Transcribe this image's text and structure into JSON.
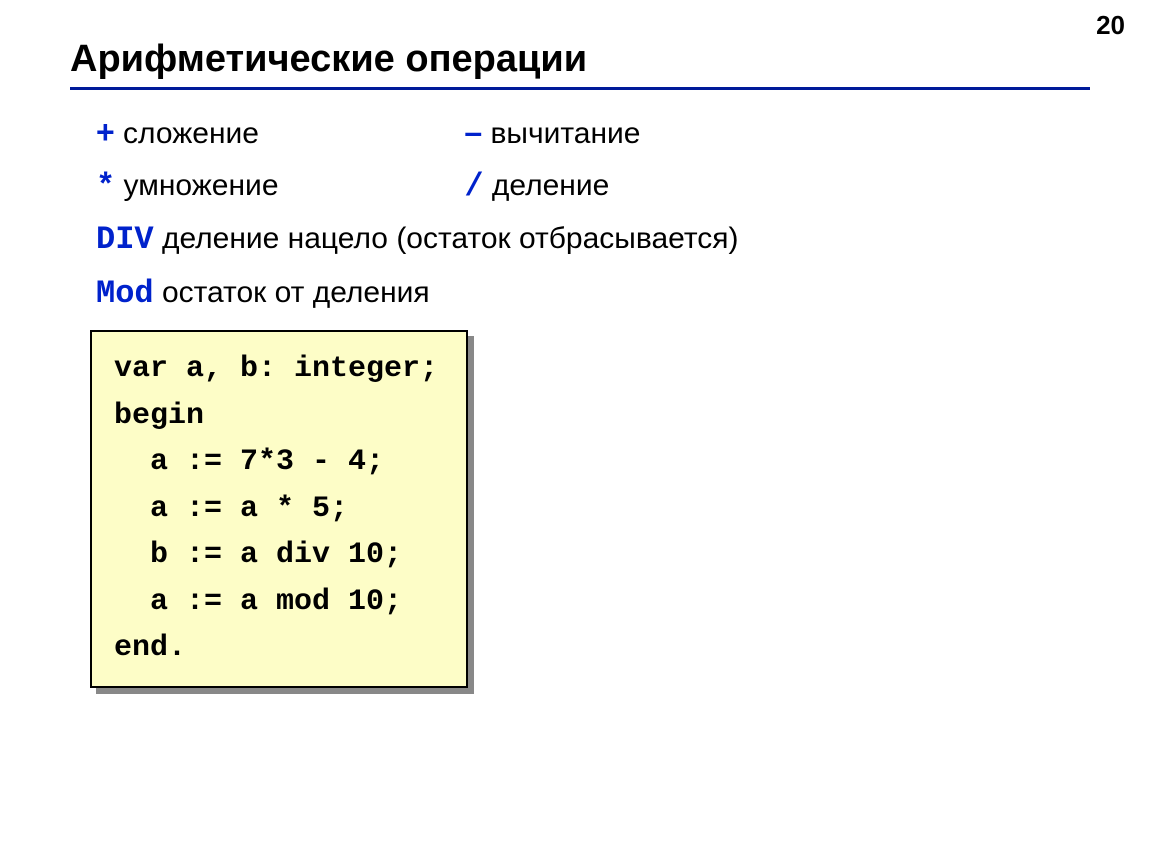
{
  "page_number": "20",
  "title": "Арифметические операции",
  "ops": {
    "plus_sym": "+",
    "plus_label": " сложение",
    "minus_sym": "–",
    "minus_label": " вычитание",
    "mul_sym": "*",
    "mul_label": " умножение",
    "div_sym": "/",
    "div_label": " деление",
    "divkw": "DIV",
    "divkw_label": " деление нацело (остаток отбрасывается)",
    "modkw": "Mod",
    "modkw_label": " остаток от деления"
  },
  "code": {
    "l1": "var a, b: integer;",
    "l2": "begin",
    "l3": "  a := 7*3 - 4;",
    "l4": "  a := a * 5;",
    "l5": "  b := a div 10;",
    "l6": "  a := a mod 10;",
    "l7": "end."
  }
}
